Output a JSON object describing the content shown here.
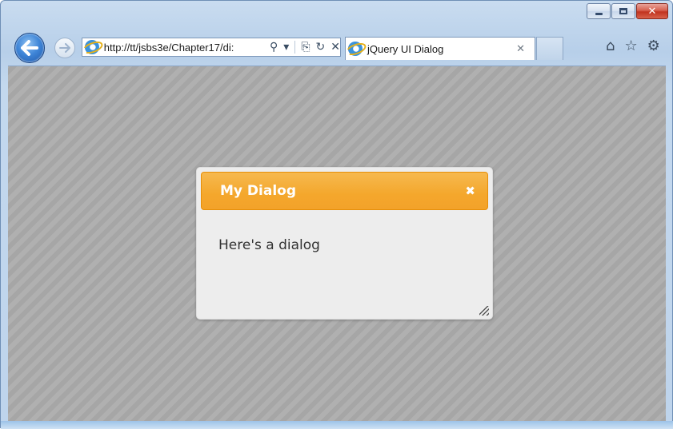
{
  "window": {
    "controls": {
      "minimize": "",
      "maximize": "",
      "close": "✕"
    }
  },
  "toolbar": {
    "back_icon": "back-arrow-icon",
    "forward_icon": "forward-arrow-icon",
    "address": {
      "url": "http://tt/jsbs3e/Chapter17/di:",
      "tools": {
        "search": "⚲",
        "dropdown": "▾",
        "compat": "⎘",
        "refresh": "↻",
        "stop": "✕"
      }
    },
    "tab": {
      "title": "jQuery UI Dialog",
      "close": "✕"
    },
    "right": {
      "home": "⌂",
      "favorites": "☆",
      "settings": "⚙"
    }
  },
  "dialog": {
    "title": "My Dialog",
    "close": "✖",
    "body": "Here's a dialog"
  },
  "colors": {
    "accent": "#f4a72c",
    "overlay": "#aaaaaa",
    "dialog_bg": "#ededed"
  }
}
